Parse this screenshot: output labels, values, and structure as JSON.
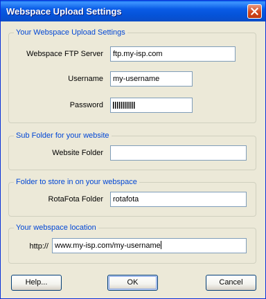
{
  "window": {
    "title": "Webspace Upload Settings"
  },
  "groups": {
    "upload": {
      "label": "Your Webspace Upload Settings",
      "ftp_label": "Webspace FTP Server",
      "ftp_value": "ftp.my-isp.com",
      "username_label": "Username",
      "username_value": "my-username",
      "password_label": "Password"
    },
    "subfolder": {
      "label": "Sub Folder for your website",
      "website_folder_label": "Website Folder",
      "website_folder_value": ""
    },
    "store": {
      "label": "Folder to store in on your webspace",
      "rotafota_label": "RotaFota Folder",
      "rotafota_value": "rotafota"
    },
    "location": {
      "label": "Your webspace location",
      "prefix": "http://",
      "url_value": "www.my-isp.com/my-username"
    }
  },
  "buttons": {
    "help": "Help...",
    "ok": "OK",
    "cancel": "Cancel"
  },
  "icons": {
    "close": "close-icon"
  },
  "colors": {
    "title_bar": "#0a5ce6",
    "group_label": "#0046d5",
    "dialog_bg": "#ece9d8"
  }
}
